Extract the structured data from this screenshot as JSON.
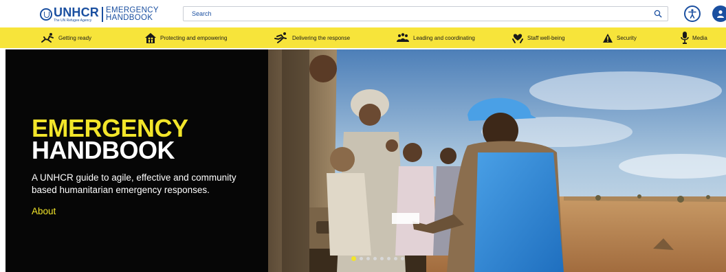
{
  "header": {
    "logo": {
      "org": "UNHCR",
      "agency": "The UN Refugee Agency",
      "product_line1": "EMERGENCY",
      "product_line2": "HANDBOOK"
    },
    "search": {
      "placeholder": "Search",
      "icon": "search-icon"
    },
    "accessibility_icon": "accessibility-icon",
    "user_icon": "user-icon"
  },
  "nav": {
    "items": [
      {
        "label": "Getting ready",
        "icon": "runner-start-icon"
      },
      {
        "label": "Protecting and empowering",
        "icon": "family-house-icon"
      },
      {
        "label": "Delivering the response",
        "icon": "running-person-icon"
      },
      {
        "label": "Leading and coordinating",
        "icon": "group-people-icon"
      },
      {
        "label": "Staff well-being",
        "icon": "heart-hands-icon"
      },
      {
        "label": "Security",
        "icon": "warning-triangle-icon"
      },
      {
        "label": "Media",
        "icon": "microphone-icon"
      }
    ]
  },
  "hero": {
    "title_line1": "EMERGENCY",
    "title_line2": "HANDBOOK",
    "description": "A UNHCR guide to agile, effective and community based humanitarian emergency responses.",
    "about_link": "About",
    "slides_count": 8,
    "active_slide": 1
  },
  "colors": {
    "brand_blue": "#1a4fa0",
    "nav_yellow": "#f7e43a",
    "title_yellow": "#f2e52a",
    "hero_bg": "#060606"
  }
}
